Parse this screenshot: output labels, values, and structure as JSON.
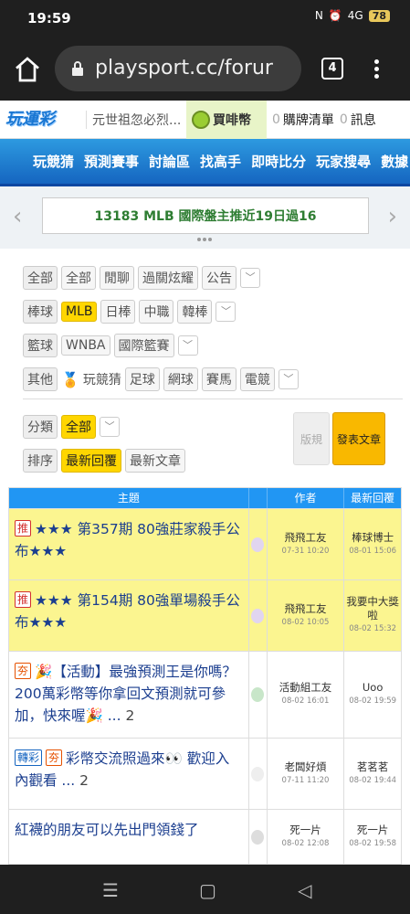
{
  "status": {
    "time": "19:59",
    "signal": "4G",
    "battery": "78"
  },
  "browser": {
    "url": "playsport.cc/forur",
    "tab_count": "4"
  },
  "site": {
    "logo": "玩運彩",
    "marquee": "元世祖忽必烈...",
    "coins_label": "買啡幣",
    "cart_count": "0",
    "cart_label": "購牌清單",
    "msg_count": "0",
    "msg_label": "訊息"
  },
  "nav": [
    "玩競猜",
    "預測賽事",
    "討論區",
    "找高手",
    "即時比分",
    "玩家搜尋",
    "數據"
  ],
  "banner": {
    "text": "13183 MLB 國際盤主推近19日過16"
  },
  "filters": {
    "all": {
      "label": "全部",
      "items": [
        "全部",
        "閒聊",
        "過關炫耀",
        "公告"
      ]
    },
    "baseball": {
      "label": "棒球",
      "items": [
        "MLB",
        "日棒",
        "中職",
        "韓棒"
      ]
    },
    "basketball": {
      "label": "籃球",
      "items": [
        "WNBA",
        "國際籃賽"
      ]
    },
    "other": {
      "label": "其他",
      "items": [
        "玩競猜",
        "足球",
        "網球",
        "賽馬",
        "電競"
      ]
    }
  },
  "sort": {
    "category_label": "分類",
    "category_value": "全部",
    "order_label": "排序",
    "order_latest_reply": "最新回覆",
    "order_latest_post": "最新文章",
    "rules_button": "版規",
    "post_button": "發表文章"
  },
  "table": {
    "headers": {
      "topic": "主題",
      "author": "作者",
      "latest": "最新回覆"
    },
    "rows": [
      {
        "tags": [
          "推"
        ],
        "title": "★★★ 第357期 80強莊家殺手公布★★★",
        "pages": "",
        "author": "飛飛工友",
        "author_time": "07-31 10:20",
        "reply": "棒球博士",
        "reply_time": "08-01 15:06",
        "hot": true
      },
      {
        "tags": [
          "推"
        ],
        "title": "★★★ 第154期 80強單場殺手公布★★★",
        "pages": "",
        "author": "飛飛工友",
        "author_time": "08-02 10:05",
        "reply": "我要中大獎啦",
        "reply_time": "08-02 15:32",
        "hot": true
      },
      {
        "tags": [
          "夯"
        ],
        "title": "🎉【活動】最強預測王是你嗎？200萬彩幣等你拿回文預測就可參加，快來喔🎉 ...",
        "pages": "2",
        "author": "活動組工友",
        "author_time": "08-02 16:01",
        "reply": "Uoo",
        "reply_time": "08-02 19:59",
        "hot": false
      },
      {
        "tags": [
          "轉彩",
          "夯"
        ],
        "title": "彩幣交流照過來👀 歡迎入內觀看 ...",
        "pages": "2",
        "author": "老闆好煩",
        "author_time": "07-11 11:20",
        "reply": "茗茗茗",
        "reply_time": "08-02 19:44",
        "hot": false
      },
      {
        "tags": [],
        "title": "紅襪的朋友可以先出門領錢了",
        "pages": "",
        "author": "死一片",
        "author_time": "08-02 12:08",
        "reply": "死一片",
        "reply_time": "08-02 19:58",
        "hot": false
      }
    ]
  }
}
